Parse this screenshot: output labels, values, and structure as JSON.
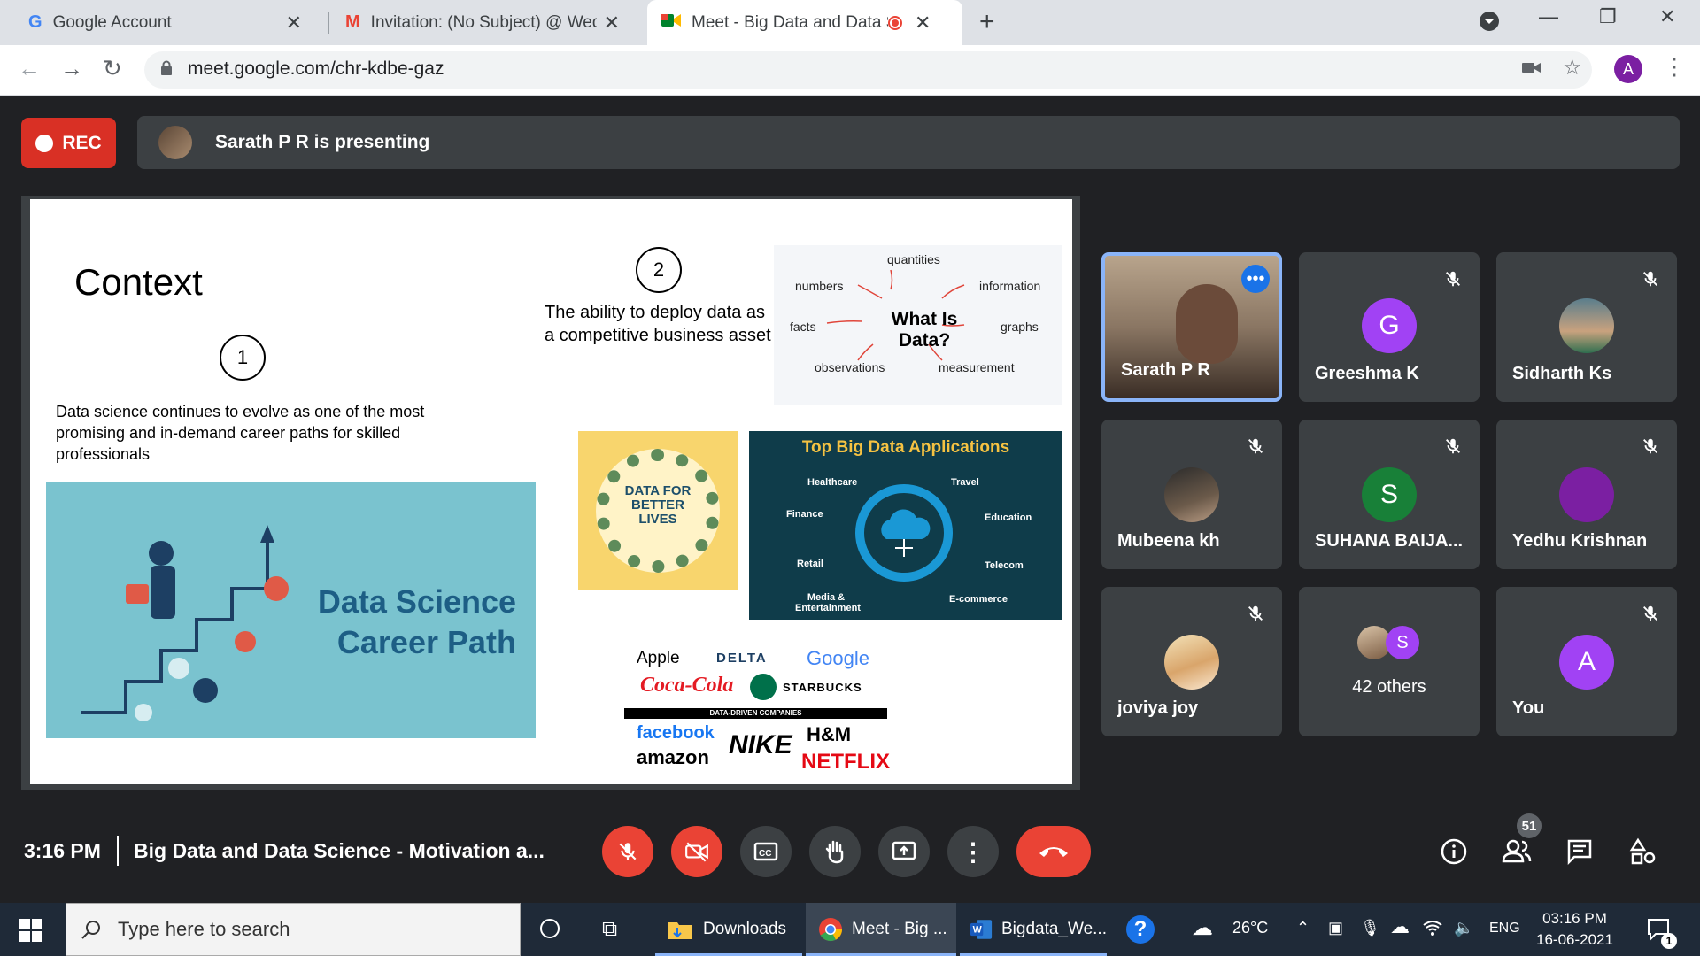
{
  "browser": {
    "tabs": [
      {
        "title": "Google Account",
        "icon": "google-icon"
      },
      {
        "title": "Invitation: (No Subject) @ Wed Ju",
        "icon": "gmail-icon"
      },
      {
        "title": "Meet - Big Data and Data Sc",
        "icon": "meet-icon",
        "active": true,
        "recording": true
      }
    ],
    "url": "meet.google.com/chr-kdbe-gaz",
    "profile_initial": "A"
  },
  "meet": {
    "rec_label": "REC",
    "presenting": "Sarath P R is presenting",
    "time": "3:16 PM",
    "meeting_title": "Big Data and Data Science - Motivation a...",
    "participants_count": "51"
  },
  "slide": {
    "title": "Context",
    "point1_number": "1",
    "point1_text": "Data science continues to evolve as one of the most promising and in-demand career paths for skilled professionals",
    "point2_number": "2",
    "point2_text": "The ability to deploy data as a competitive business asset",
    "career_image_text_line1": "Data Science",
    "career_image_text_line2": "Career Path",
    "data_words": {
      "center": "What Is Data?",
      "words": [
        "quantities",
        "numbers",
        "information",
        "facts",
        "graphs",
        "observations",
        "measurement"
      ]
    },
    "dfbl_text": "DATA FOR BETTER LIVES",
    "bda": {
      "title": "Top Big Data Applications",
      "left": [
        "Healthcare",
        "Finance",
        "Retail",
        "Media & Entertainment"
      ],
      "right": [
        "Travel",
        "Education",
        "Telecom",
        "E-commerce"
      ]
    },
    "logos": {
      "row1": [
        "Apple",
        "DELTA",
        "Google"
      ],
      "row2": [
        "Coca-Cola",
        "STARBUCKS"
      ],
      "banner": "DATA-DRIVEN COMPANIES",
      "row3": [
        "facebook",
        "NIKE",
        "H&M"
      ],
      "row4": [
        "amazon",
        "NETFLIX"
      ]
    }
  },
  "participants": [
    {
      "name": "Sarath P R",
      "type": "video"
    },
    {
      "name": "Greeshma K",
      "initial": "G",
      "color": "#a142f4"
    },
    {
      "name": "Sidharth Ks",
      "type": "photo"
    },
    {
      "name": "Mubeena kh",
      "type": "photo"
    },
    {
      "name": "SUHANA BAIJA...",
      "initial": "S",
      "color": "#188038"
    },
    {
      "name": "Yedhu Krishnan",
      "initial": "",
      "color": "#7b1fa2"
    },
    {
      "name": "joviya joy",
      "type": "photo"
    },
    {
      "name": "42 others",
      "initial": "S",
      "color": "#a142f4"
    },
    {
      "name": "You",
      "initial": "A",
      "color": "#a142f4"
    }
  ],
  "taskbar": {
    "search_placeholder": "Type here to search",
    "items": [
      "Downloads",
      "Meet - Big ...",
      "Bigdata_We..."
    ],
    "weather": "26°C",
    "lang": "ENG",
    "clock_time": "03:16 PM",
    "clock_date": "16-06-2021",
    "notif_count": "1"
  }
}
